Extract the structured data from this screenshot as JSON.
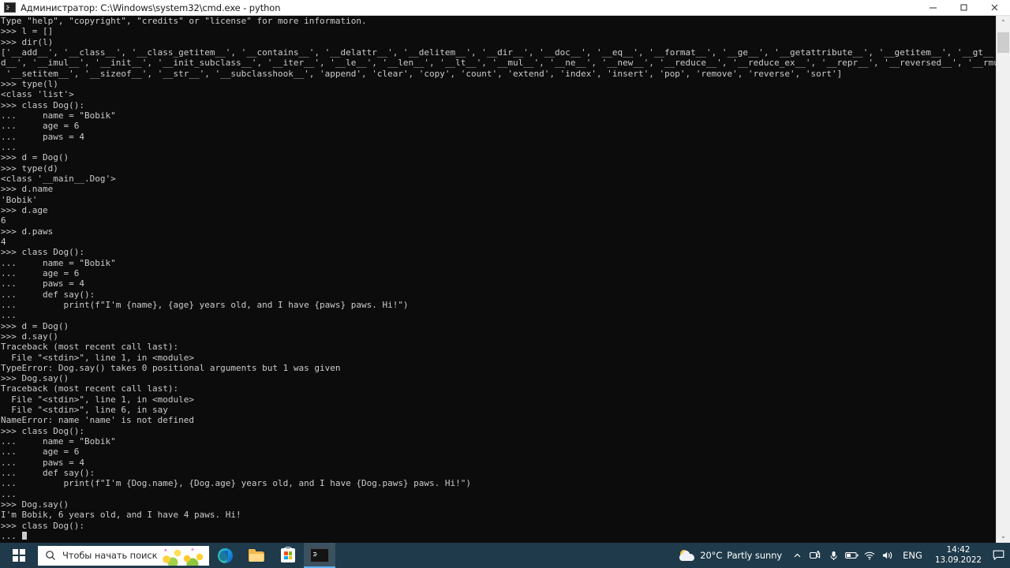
{
  "window": {
    "title": "Администратор: C:\\Windows\\system32\\cmd.exe - python",
    "icon": "cmd-icon",
    "minimize_label": "—",
    "maximize_label": "□",
    "close_label": "×"
  },
  "console": {
    "background_color": "#0c0c0c",
    "text_color": "#cccccc",
    "lines": [
      "Type \"help\", \"copyright\", \"credits\" or \"license\" for more information.",
      ">>> l = []",
      ">>> dir(l)",
      "['__add__', '__class__', '__class_getitem__', '__contains__', '__delattr__', '__delitem__', '__dir__', '__doc__', '__eq__', '__format__', '__ge__', '__getattribute__', '__getitem__', '__gt__', '__hash__', '__iad",
      "d__', '__imul__', '__init__', '__init_subclass__', '__iter__', '__le__', '__len__', '__lt__', '__mul__', '__ne__', '__new__', '__reduce__', '__reduce_ex__', '__repr__', '__reversed__', '__rmul__', '__setattr__',",
      " '__setitem__', '__sizeof__', '__str__', '__subclasshook__', 'append', 'clear', 'copy', 'count', 'extend', 'index', 'insert', 'pop', 'remove', 'reverse', 'sort']",
      ">>> type(l)",
      "<class 'list'>",
      ">>> class Dog():",
      "...     name = \"Bobik\"",
      "...     age = 6",
      "...     paws = 4",
      "...",
      ">>> d = Dog()",
      ">>> type(d)",
      "<class '__main__.Dog'>",
      ">>> d.name",
      "'Bobik'",
      ">>> d.age",
      "6",
      ">>> d.paws",
      "4",
      ">>> class Dog():",
      "...     name = \"Bobik\"",
      "...     age = 6",
      "...     paws = 4",
      "...     def say():",
      "...         print(f\"I'm {name}, {age} years old, and I have {paws} paws. Hi!\")",
      "...",
      ">>> d = Dog()",
      ">>> d.say()",
      "Traceback (most recent call last):",
      "  File \"<stdin>\", line 1, in <module>",
      "TypeError: Dog.say() takes 0 positional arguments but 1 was given",
      ">>> Dog.say()",
      "Traceback (most recent call last):",
      "  File \"<stdin>\", line 1, in <module>",
      "  File \"<stdin>\", line 6, in say",
      "NameError: name 'name' is not defined",
      ">>> class Dog():",
      "...     name = \"Bobik\"",
      "...     age = 6",
      "...     paws = 4",
      "...     def say():",
      "...         print(f\"I'm {Dog.name}, {Dog.age} years old, and I have {Dog.paws} paws. Hi!\")",
      "...",
      ">>> Dog.say()",
      "I'm Bobik, 6 years old, and I have 4 paws. Hi!",
      ">>> class Dog():"
    ],
    "prompt_line": "... "
  },
  "scrollbar": {
    "up_arrow": "⌃",
    "down_arrow": "⌄"
  },
  "taskbar": {
    "background_color": "#1f3a4a",
    "start": {
      "name": "start-button",
      "icon": "windows-logo-icon"
    },
    "search": {
      "placeholder": "Чтобы начать поиск, введите",
      "icon": "search-icon",
      "sparkle": "✦"
    },
    "apps": [
      {
        "name": "edge",
        "icon": "edge-icon",
        "active": false
      },
      {
        "name": "file-explorer",
        "icon": "folder-icon",
        "active": false
      },
      {
        "name": "microsoft-store",
        "icon": "store-icon",
        "active": false
      },
      {
        "name": "command-prompt",
        "icon": "cmd-icon",
        "active": true
      }
    ],
    "tray": {
      "weather": {
        "temperature": "20°C",
        "condition": "Partly sunny",
        "icon": "sun-cloud-icon"
      },
      "show_hidden_icons": "⌃",
      "icons": [
        "camera-icon",
        "microphone-icon",
        "battery-icon",
        "wifi-icon",
        "volume-icon"
      ],
      "language": "ENG",
      "time": "14:42",
      "date": "13.09.2022",
      "notifications_icon": "speech-bubble-icon"
    }
  }
}
